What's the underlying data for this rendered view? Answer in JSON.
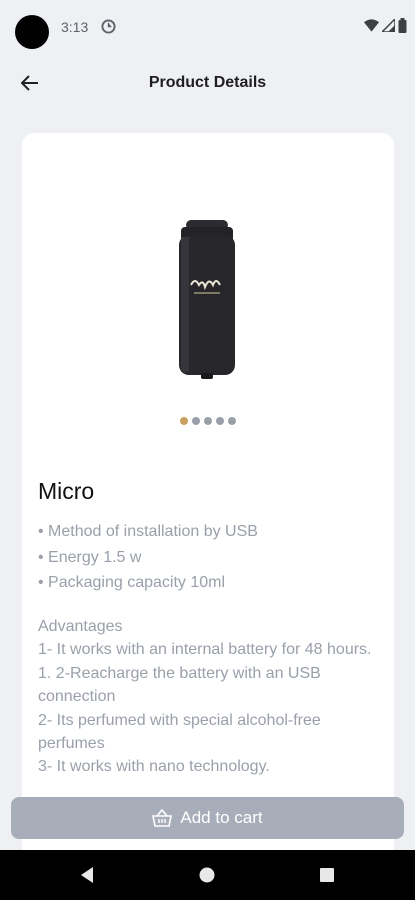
{
  "status_bar": {
    "time": "3:13"
  },
  "header": {
    "title": "Product Details"
  },
  "product": {
    "name": "Micro",
    "image_page": 1,
    "image_pages": 5,
    "specs": [
      "Method of installation by USB",
      "Energy 1.5 w",
      "Packaging capacity 10ml"
    ],
    "description": "Advantages\n1- It works with an internal battery for 48 hours.\n1. 2-Reacharge the battery with an USB connection\n2- Its perfumed with special alcohol-free perfumes\n3- It works with nano technology."
  },
  "actions": {
    "add_to_cart": "Add to cart"
  },
  "colors": {
    "background": "#eef0f4",
    "accent_dot": "#c8a060",
    "button": "#a8adba"
  }
}
